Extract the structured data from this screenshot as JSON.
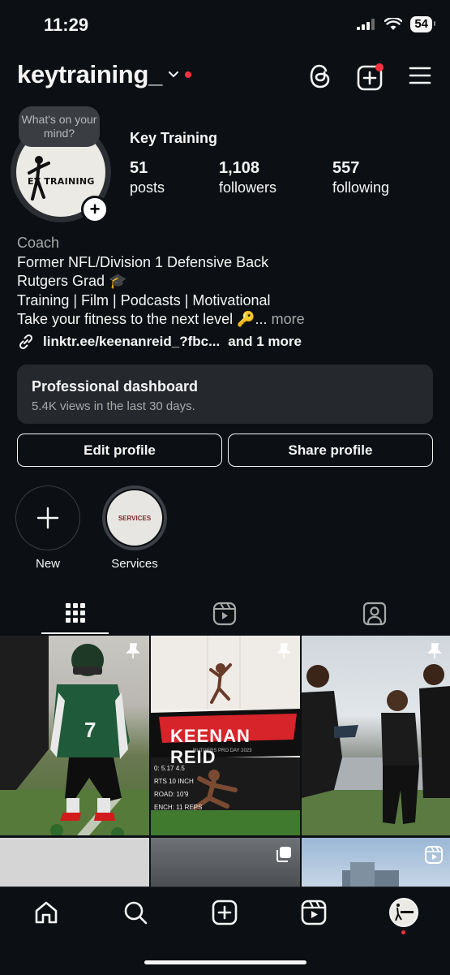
{
  "status_bar": {
    "time": "11:29",
    "battery": "54"
  },
  "header": {
    "username": "keytraining_"
  },
  "profile": {
    "bubble_note": "What's on your mind?",
    "avatar_text": "EY TRAINING",
    "display_name": "Key Training",
    "stats": [
      {
        "value": "51",
        "label": "posts"
      },
      {
        "value": "1,108",
        "label": "followers"
      },
      {
        "value": "557",
        "label": "following"
      }
    ],
    "bio": {
      "category": "Coach",
      "lines": [
        "Former NFL/Division 1 Defensive Back",
        "Rutgers Grad 🎓",
        "Training | Film | Podcasts | Motivational",
        "Take your fitness to the next level 🔑..."
      ],
      "more": "more"
    },
    "link": {
      "url": "linktr.ee/keenanreid_?fbc...",
      "extra": "and 1 more"
    }
  },
  "dashboard": {
    "title": "Professional dashboard",
    "subtitle": "5.4K views in the last 30 days."
  },
  "buttons": {
    "edit": "Edit profile",
    "share": "Share profile"
  },
  "highlights": [
    {
      "label": "New"
    },
    {
      "label": "Services",
      "cover_text": "SERVICES"
    }
  ],
  "grid_posts": [
    {
      "kind": "photo",
      "pinned": true,
      "jersey": "7"
    },
    {
      "kind": "graphic",
      "pinned": true,
      "title": "KEENAN REID",
      "subtitle": "RUTGERS PRO DAY 2023"
    },
    {
      "kind": "photo",
      "pinned": true
    }
  ],
  "colors": {
    "background": "#0c1014",
    "notification": "#ff3040",
    "card": "#25292e"
  }
}
